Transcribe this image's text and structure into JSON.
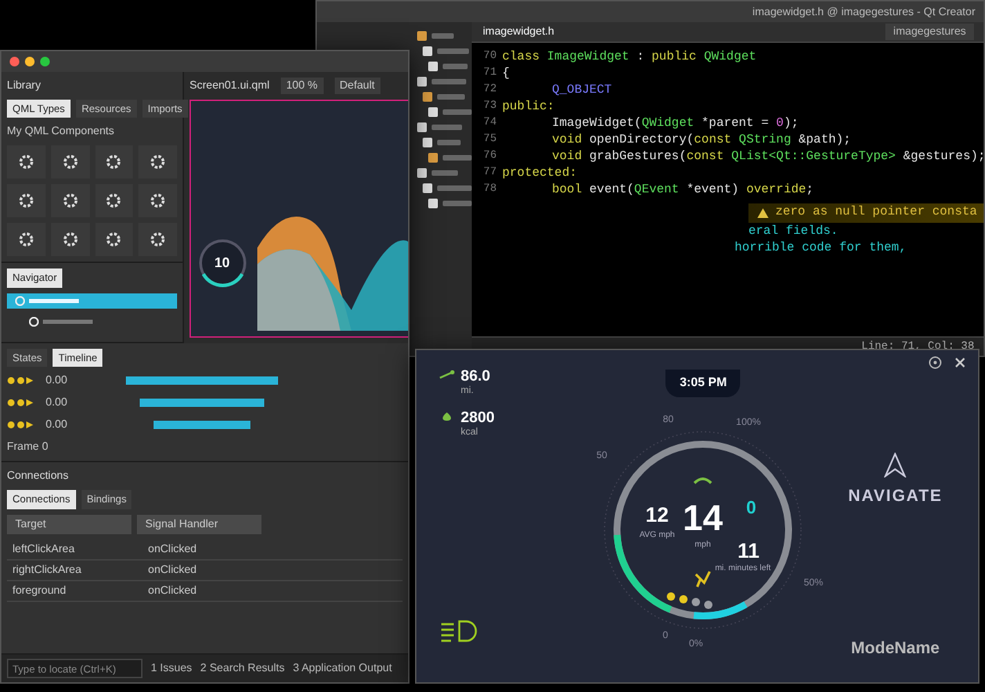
{
  "code_editor": {
    "title": "imagewidget.h @ imagegestures - Qt Creator",
    "file_tab": "imagewidget.h",
    "project_selector": "imagegestures",
    "lines": [
      {
        "number": "70",
        "indented": false,
        "tokens": [
          {
            "kind": "keyword",
            "text": "class "
          },
          {
            "kind": "type",
            "text": "ImageWidget"
          },
          {
            "kind": "plain",
            "text": " : "
          },
          {
            "kind": "keyword",
            "text": "public "
          },
          {
            "kind": "type",
            "text": "QWidget"
          }
        ]
      },
      {
        "number": "71",
        "indented": false,
        "tokens": [
          {
            "kind": "plain",
            "text": "{"
          }
        ]
      },
      {
        "number": "72",
        "indented": true,
        "tokens": [
          {
            "kind": "macro",
            "text": "Q_OBJECT"
          }
        ]
      },
      {
        "number": "73",
        "indented": false,
        "tokens": [
          {
            "kind": "keyword",
            "text": "public:"
          }
        ]
      },
      {
        "number": "74",
        "indented": true,
        "tokens": [
          {
            "kind": "plain",
            "text": "ImageWidget("
          },
          {
            "kind": "type",
            "text": "QWidget"
          },
          {
            "kind": "plain",
            "text": " *parent = "
          },
          {
            "kind": "number",
            "text": "0"
          },
          {
            "kind": "plain",
            "text": ");"
          }
        ]
      },
      {
        "number": "75",
        "indented": true,
        "tokens": [
          {
            "kind": "keyword",
            "text": "void "
          },
          {
            "kind": "plain",
            "text": "openDirectory("
          },
          {
            "kind": "keyword",
            "text": "const "
          },
          {
            "kind": "type",
            "text": "QString"
          },
          {
            "kind": "plain",
            "text": " &path);"
          }
        ]
      },
      {
        "number": "76",
        "indented": true,
        "tokens": [
          {
            "kind": "keyword",
            "text": "void "
          },
          {
            "kind": "plain",
            "text": "grabGestures("
          },
          {
            "kind": "keyword",
            "text": "const "
          },
          {
            "kind": "type",
            "text": "QList<Qt::GestureType>"
          },
          {
            "kind": "plain",
            "text": " &gestures);"
          }
        ]
      },
      {
        "number": "77",
        "indented": false,
        "tokens": [
          {
            "kind": "keyword",
            "text": "protected:"
          }
        ]
      },
      {
        "number": "78",
        "indented": true,
        "tokens": [
          {
            "kind": "keyword",
            "text": "bool "
          },
          {
            "kind": "plain",
            "text": "event("
          },
          {
            "kind": "type",
            "text": "QEvent"
          },
          {
            "kind": "plain",
            "text": " *event) "
          },
          {
            "kind": "keyword",
            "text": "override"
          },
          {
            "kind": "plain",
            "text": ";"
          }
        ]
      }
    ],
    "warning": "zero as null pointer consta",
    "tail_lines": [
      "eral fields.",
      "horrible code for them,"
    ],
    "status": "Line: 71, Col: 38"
  },
  "design_studio": {
    "canvas_title": "Screen01.ui.qml",
    "library": {
      "title": "Library",
      "tabs": [
        {
          "label": "QML Types",
          "selected": true
        },
        {
          "label": "Resources",
          "selected": false
        },
        {
          "label": "Imports",
          "selected": false
        }
      ],
      "section": "My QML Components"
    },
    "navigator": {
      "tab": "Navigator"
    },
    "toolbar": {
      "zoom": "100 %",
      "state": "Default"
    },
    "mini_gauge": {
      "value": "10"
    },
    "timeline": {
      "tabs": [
        {
          "label": "States",
          "selected": false
        },
        {
          "label": "Timeline",
          "selected": true
        }
      ],
      "values": [
        "0.00",
        "0.00",
        "0.00"
      ],
      "frame": "Frame 0"
    },
    "connections": {
      "title": "Connections",
      "tabs": [
        {
          "label": "Connections",
          "selected": true
        },
        {
          "label": "Bindings",
          "selected": false
        }
      ],
      "columns": [
        "Target",
        "Signal Handler"
      ],
      "rows": [
        {
          "target": "leftClickArea",
          "handler": "onClicked"
        },
        {
          "target": "rightClickArea",
          "handler": "onClicked"
        },
        {
          "target": "foreground",
          "handler": "onClicked"
        }
      ]
    },
    "output_tabs": [
      "1 Issues",
      "2 Search Results",
      "3 Application Output"
    ],
    "locator": {
      "placeholder": "Type to locate (Ctrl+K)"
    }
  },
  "cluster": {
    "stats": [
      {
        "value": "86.0",
        "unit": "mi."
      },
      {
        "value": "2800",
        "unit": "kcal"
      }
    ],
    "time": "3:05 PM",
    "gauge": {
      "center_value": "14",
      "center_unit": "mph",
      "left_value": "12",
      "left_unit": "AVG mph",
      "right_value": "0",
      "bottom_value": "11",
      "bottom_unit": "mi. minutes left",
      "ticks": [
        "50",
        "80",
        "100%",
        "50%",
        "0",
        "0%"
      ],
      "dots": [
        {
          "on": true
        },
        {
          "on": true
        },
        {
          "on": false
        },
        {
          "on": false
        }
      ]
    },
    "navigate": "NAVIGATE",
    "mode_name": "ModeName"
  }
}
